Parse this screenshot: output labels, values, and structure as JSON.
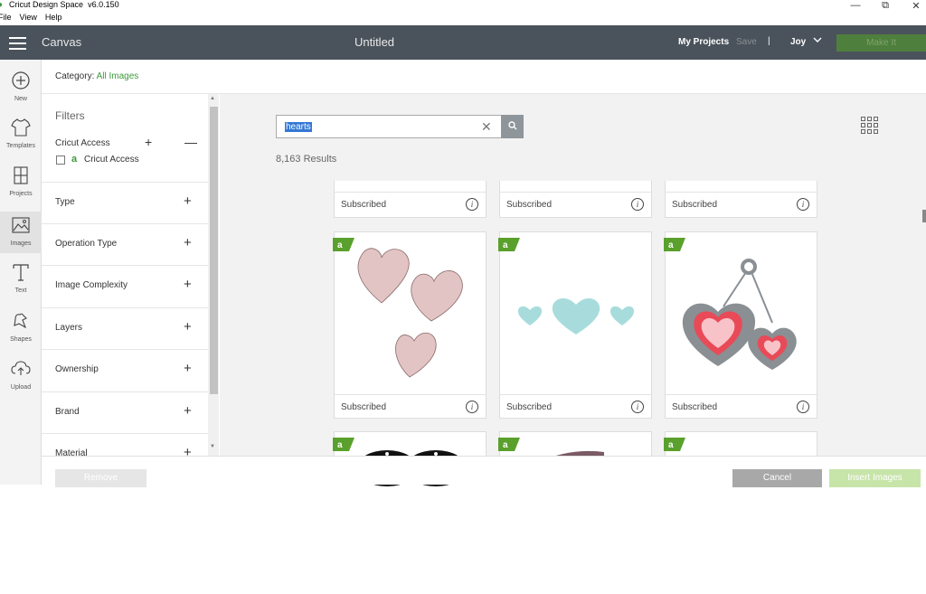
{
  "window": {
    "app_name": "Cricut Design Space",
    "version": "v6.0.150",
    "menu": [
      "File",
      "View",
      "Help"
    ],
    "controls": {
      "minimize": "—",
      "restore": "⧉",
      "close": "✕"
    }
  },
  "header": {
    "canvas_label": "Canvas",
    "doc_title": "Untitled",
    "my_projects": "My Projects",
    "save": "Save",
    "divider": "|",
    "user": "Joy",
    "make_it": "Make It"
  },
  "rail": [
    {
      "label": "New",
      "icon": "plus-circle-icon"
    },
    {
      "label": "Templates",
      "icon": "shirt-icon"
    },
    {
      "label": "Projects",
      "icon": "projects-icon"
    },
    {
      "label": "Images",
      "icon": "image-icon"
    },
    {
      "label": "Text",
      "icon": "text-icon"
    },
    {
      "label": "Shapes",
      "icon": "shapes-icon"
    },
    {
      "label": "Upload",
      "icon": "upload-cloud-icon"
    }
  ],
  "category": {
    "label": "Category:",
    "value": "All Images"
  },
  "filters": {
    "title": "Filters",
    "access_title": "Cricut Access",
    "access_checkbox_label": "Cricut Access",
    "access_badge": "a",
    "rows": [
      "Type",
      "Operation Type",
      "Image Complexity",
      "Layers",
      "Ownership",
      "Brand",
      "Material"
    ]
  },
  "search": {
    "value": "hearts"
  },
  "results": "8,163 Results",
  "cards": {
    "subscribed": "Subscribed",
    "info": "i",
    "badge": "a"
  },
  "bottom": {
    "remove": "Remove",
    "cancel": "Cancel",
    "insert": "Insert Images"
  },
  "colors": {
    "header": "#4a535b",
    "accent_green": "#3c9a3c",
    "make_it": "#4f7f3d",
    "insert": "#c7e4a9"
  }
}
